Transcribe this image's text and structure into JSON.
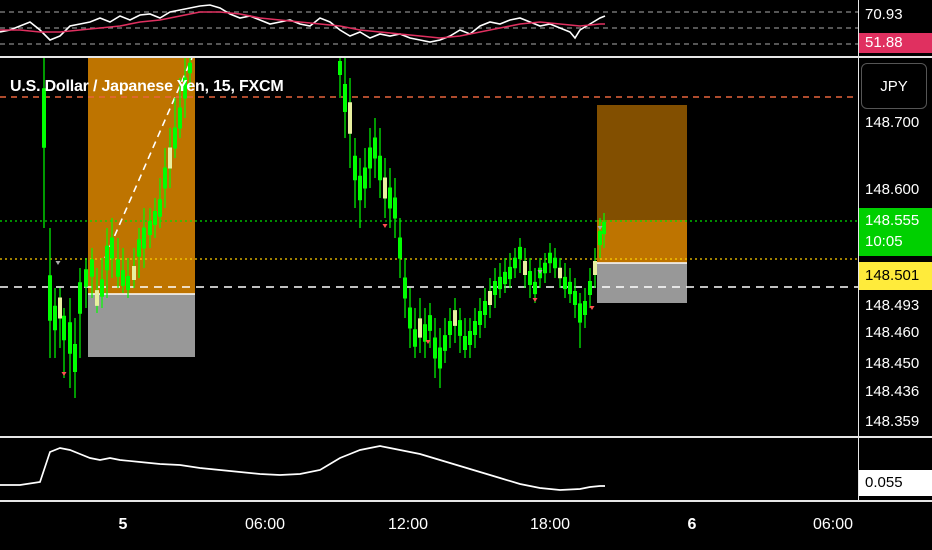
{
  "chart_title": "U.S. Dollar / Japanese Yen, 15, FXCM",
  "currency_button": "JPY",
  "rsi_panel": {
    "value_white": "70.93",
    "value_red": "51.88"
  },
  "price_axis": {
    "labels": [
      "148.700",
      "148.600",
      "148.493",
      "148.460",
      "148.450",
      "148.436",
      "148.359"
    ],
    "current_price": "148.555",
    "countdown": "10:05",
    "yellow_line_price": "148.501"
  },
  "oscillator_panel": {
    "value": "0.055"
  },
  "time_axis": {
    "labels": [
      "5",
      "06:00",
      "12:00",
      "18:00",
      "6",
      "06:00"
    ]
  },
  "colors": {
    "up_candle": "#00ff00",
    "down_candle": "#00ff00",
    "current_price_badge": "#00d000",
    "yellow_badge": "#ffeb3b",
    "rsi_red_badge": "#e03060",
    "target_zone": "#c87a00",
    "stop_zone": "#a0a0a0"
  }
}
